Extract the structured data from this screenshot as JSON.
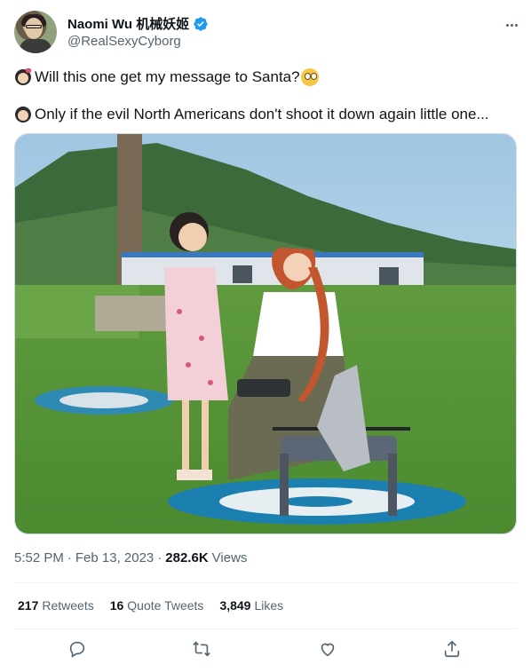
{
  "author": {
    "name": "Naomi Wu 机械妖姬",
    "handle": "@RealSexyCyborg",
    "verified": true
  },
  "tweet": {
    "line1": "Will this one get my message to Santa?",
    "line2": "Only if the evil North Americans don't shoot it down again little one...",
    "line1_emojis": [
      "girl-emoji",
      "rolling-eyes-emoji"
    ],
    "line2_emojis": [
      "woman-emoji"
    ]
  },
  "meta": {
    "time": "5:52 PM",
    "sep1": "·",
    "date": "Feb 13, 2023",
    "sep2": "·",
    "views_count": "282.6K",
    "views_label": "Views"
  },
  "stats": {
    "retweets_count": "217",
    "retweets_label": "Retweets",
    "quotes_count": "16",
    "quotes_label": "Quote Tweets",
    "likes_count": "3,849",
    "likes_label": "Likes"
  },
  "actions": [
    "reply-icon",
    "retweet-icon",
    "like-icon",
    "share-icon"
  ],
  "colors": {
    "verified": "#1d9bf0",
    "secondary_text": "#536471",
    "primary_text": "#0f1419",
    "border": "#eff3f4"
  }
}
